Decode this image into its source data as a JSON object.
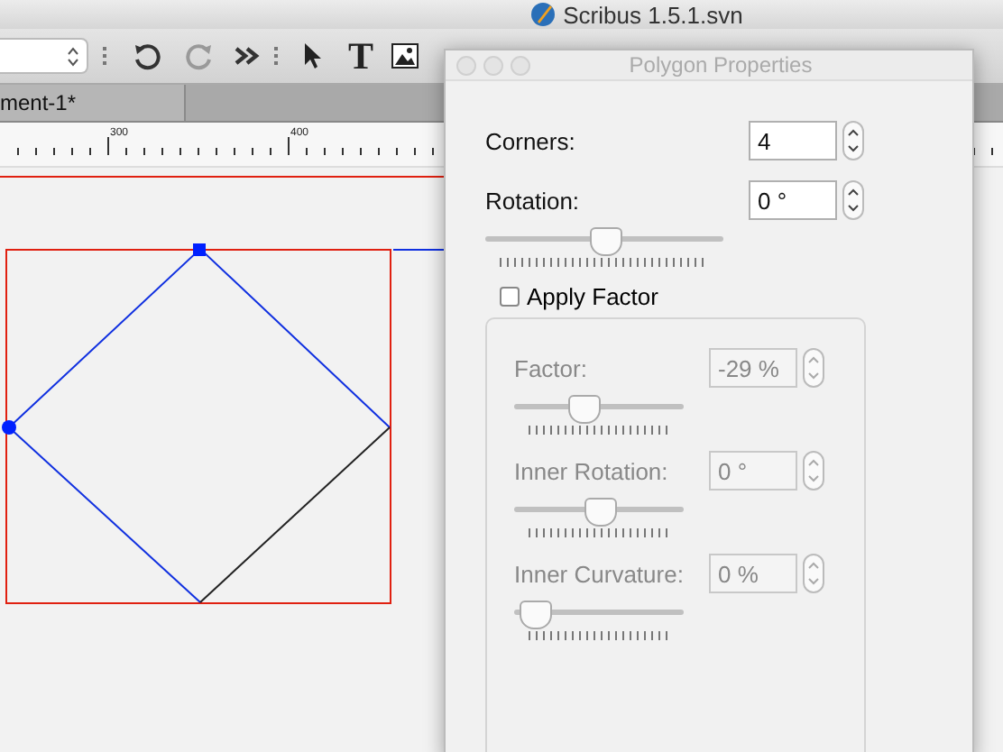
{
  "app_title": "Scribus 1.5.1.svn",
  "toolbar": {
    "text_tool": "T"
  },
  "document_tab": {
    "label": "ment-1*"
  },
  "ruler": {
    "labels": [
      "300",
      "400"
    ]
  },
  "dialog": {
    "title": "Polygon Properties",
    "rows": [
      {
        "kind": "spin",
        "label": "Corners:",
        "value": "4",
        "disabled": false
      },
      {
        "kind": "slider",
        "label": "Rotation:",
        "value": "0 °",
        "level": 0.5,
        "disabled": false
      }
    ],
    "apply_factor": {
      "label": "Apply Factor",
      "checked": false
    },
    "factor_rows": [
      {
        "kind": "slider",
        "label": "Factor:",
        "value": "-29 %",
        "level": 0.38,
        "disabled": true
      },
      {
        "kind": "slider",
        "label": "Inner Rotation:",
        "value": "0 °",
        "level": 0.5,
        "disabled": true
      },
      {
        "kind": "slider",
        "label": "Inner Curvature:",
        "value": "0 %",
        "level": 0,
        "disabled": true
      }
    ]
  }
}
